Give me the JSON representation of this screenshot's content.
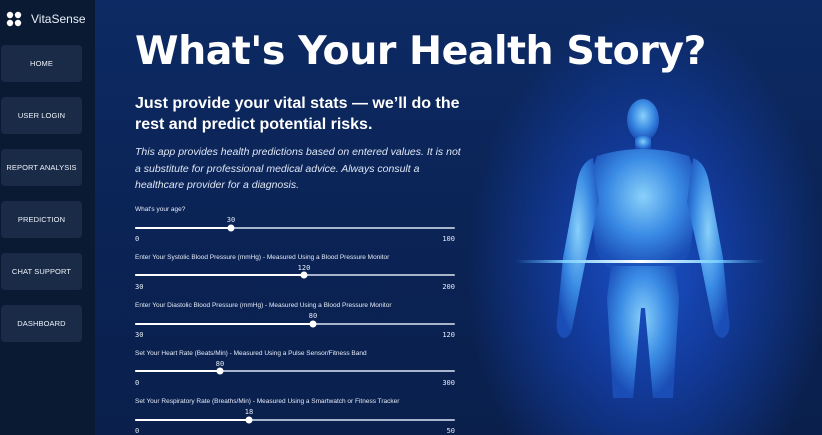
{
  "app": {
    "name": "VitaSense"
  },
  "sidebar": {
    "items": [
      {
        "label": "HOME"
      },
      {
        "label": "USER LOGIN"
      },
      {
        "label": "REPORT ANALYSIS"
      },
      {
        "label": "PREDICTION"
      },
      {
        "label": "CHAT SUPPORT"
      },
      {
        "label": "DASHBOARD"
      }
    ]
  },
  "main": {
    "title": "What's Your Health Story?",
    "subtitle": "Just provide your vital stats — we’ll do the rest and predict potential risks.",
    "description": "This app provides health predictions based on entered values. It is not a substitute for professional medical advice. Always consult a healthcare provider for a diagnosis."
  },
  "sliders": [
    {
      "label": "What's your age?",
      "value": "30",
      "min": "0",
      "max": "100"
    },
    {
      "label": "Enter Your Systolic Blood Pressure (mmHg) - Measured Using a Blood Pressure Monitor",
      "value": "120",
      "min": "30",
      "max": "200"
    },
    {
      "label": "Enter Your Diastolic Blood Pressure (mmHg) - Measured Using a Blood Pressure Monitor",
      "value": "80",
      "min": "30",
      "max": "120"
    },
    {
      "label": "Set Your Heart Rate (Beats/Min) - Measured Using a Pulse Sensor/Fitness Band",
      "value": "80",
      "min": "0",
      "max": "300"
    },
    {
      "label": "Set Your Respiratory Rate (Breaths/Min) - Measured Using a Smartwatch or Fitness Tracker",
      "value": "18",
      "min": "0",
      "max": "50"
    }
  ],
  "colors": {
    "sidebar_bg": "#0b1a33",
    "nav_bg": "#1a2b47",
    "main_bg": "#0b2456",
    "glow": "#4fb8ff"
  }
}
